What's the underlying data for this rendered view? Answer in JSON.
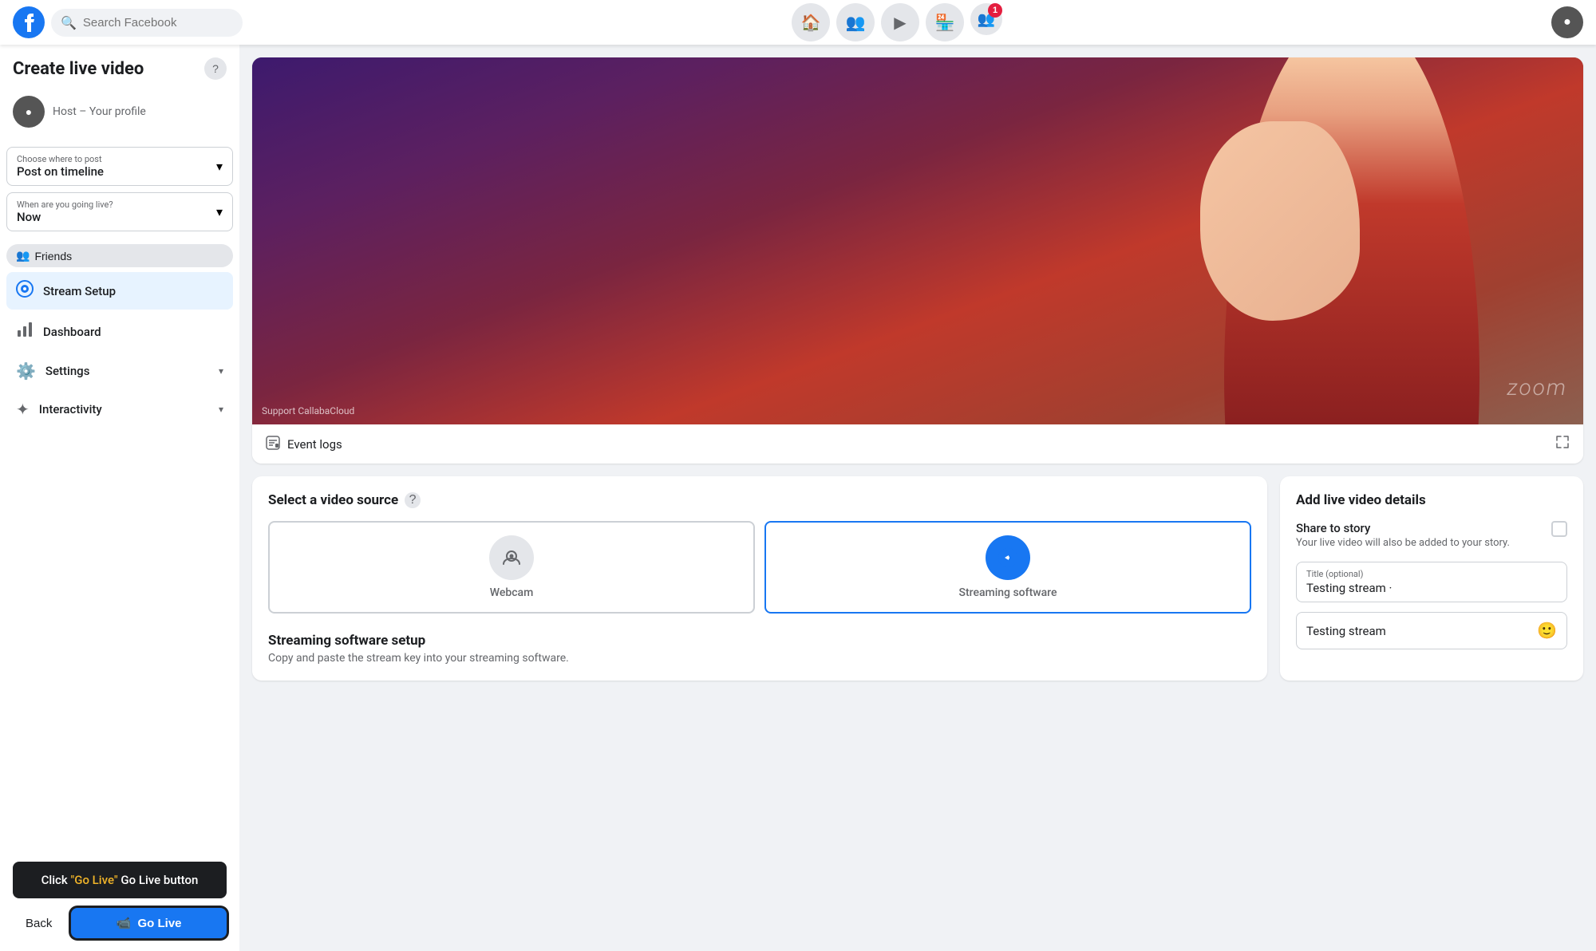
{
  "topnav": {
    "search_placeholder": "Search Facebook",
    "notification_count": "1"
  },
  "sidebar": {
    "title": "Create live video",
    "host_name": "Host – Your profile",
    "where_to_post_label": "Choose where to post",
    "where_to_post_value": "Post on timeline",
    "when_going_live_label": "When are you going live?",
    "when_going_live_value": "Now",
    "friends_badge": "Friends",
    "nav_items": [
      {
        "label": "Stream Setup",
        "icon": "📡",
        "active": true
      },
      {
        "label": "Dashboard",
        "icon": "📊",
        "active": false
      },
      {
        "label": "Settings",
        "icon": "⚙️",
        "active": false,
        "has_chevron": true
      },
      {
        "label": "Interactivity",
        "icon": "✦",
        "active": false,
        "has_chevron": true
      }
    ],
    "go_live_hint": "Click \"Go Live\" button",
    "back_label": "Back",
    "go_live_label": "Go Live"
  },
  "video_preview": {
    "tag": "",
    "watermark": "zoom",
    "support_text": "Support CallabaCloud"
  },
  "event_logs": {
    "label": "Event logs"
  },
  "video_source": {
    "title": "Select a video source",
    "options": [
      {
        "label": "Webcam",
        "icon": "📷",
        "selected": false
      },
      {
        "label": "Streaming software",
        "icon": "🎯",
        "selected": true
      }
    ]
  },
  "streaming_setup": {
    "title": "Streaming software setup",
    "description": "Copy and paste the stream key into your streaming software."
  },
  "live_details": {
    "title": "Add live video details",
    "share_to_story_label": "Share to story",
    "share_to_story_sub": "Your live video will also be added to your story.",
    "title_field_label": "Title (optional)",
    "title_field_value": "Testing stream ·",
    "description_value": "Testing stream"
  }
}
